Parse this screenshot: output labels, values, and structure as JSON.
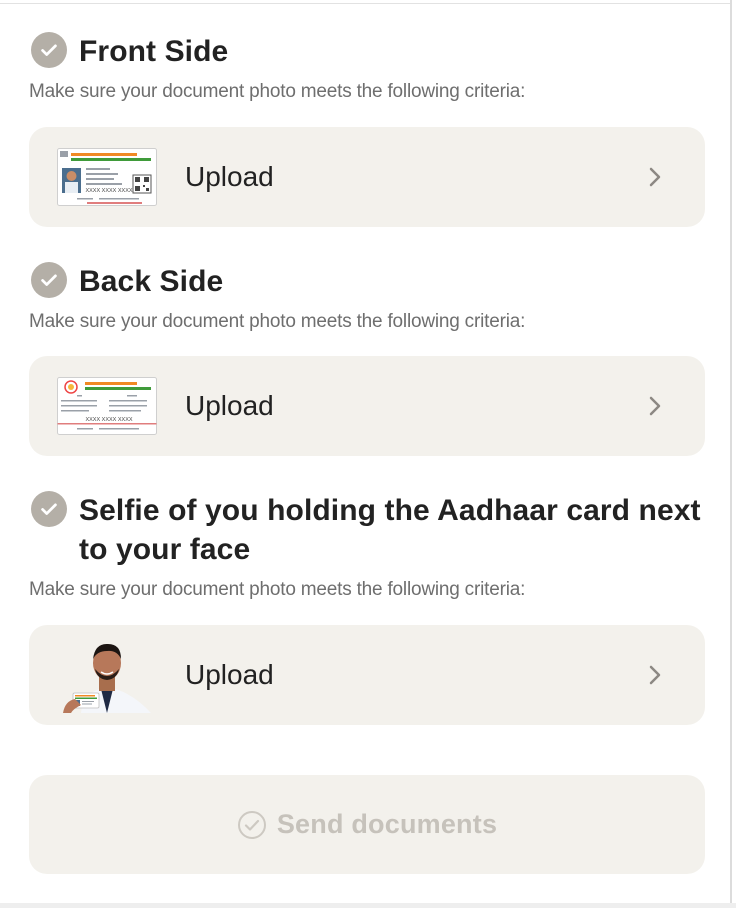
{
  "sections": [
    {
      "title": "Front Side",
      "subtitle": "Make sure your document photo meets the following criteria:",
      "upload_label": "Upload",
      "card_number": "XXXX XXXX XXXX"
    },
    {
      "title": "Back Side",
      "subtitle": "Make sure your document photo meets the following criteria:",
      "upload_label": "Upload",
      "card_number": "XXXX XXXX XXXX"
    },
    {
      "title": "Selfie of you holding the Aadhaar card next to your face",
      "subtitle": "Make sure your document photo meets the following criteria:",
      "upload_label": "Upload"
    }
  ],
  "send_button": {
    "label": "Send documents"
  },
  "colors": {
    "check_fill": "#b4afa7",
    "card_bg": "#f3f1ec",
    "saffron": "#f08a24",
    "green": "#3f9b3a",
    "disabled_text": "#c6c2bb"
  }
}
